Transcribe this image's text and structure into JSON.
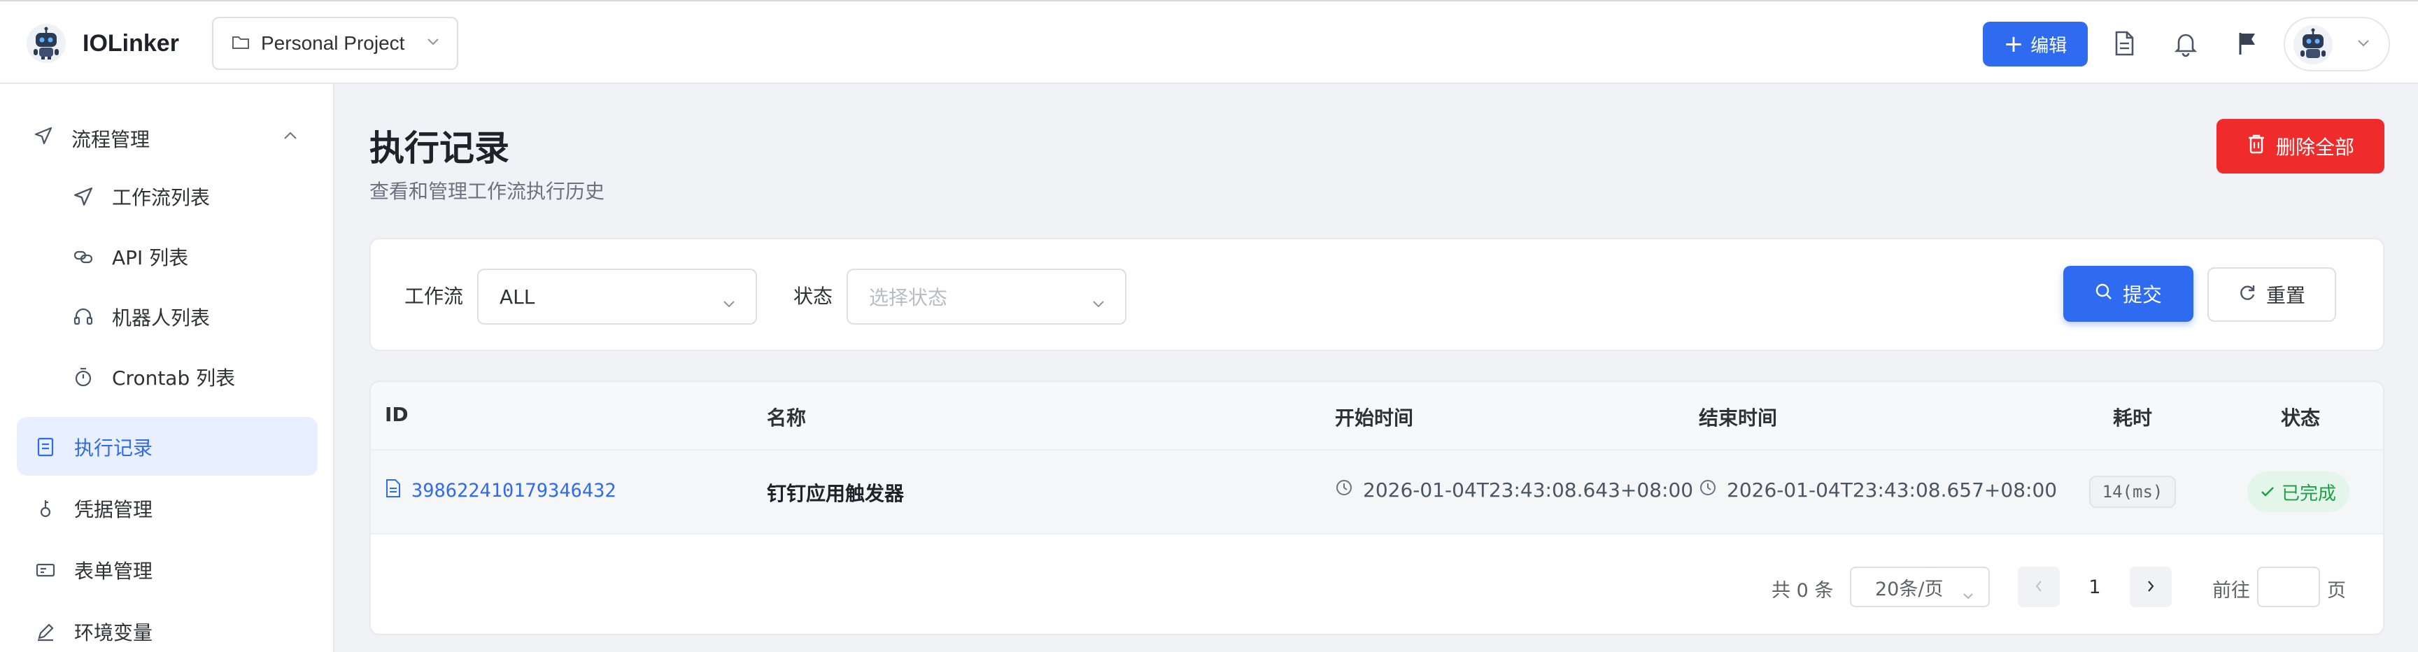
{
  "app": {
    "name": "IOLinker"
  },
  "project": {
    "selected": "Personal Project"
  },
  "header": {
    "edit_label": "编辑"
  },
  "sidebar": {
    "group_label": "流程管理",
    "items": [
      {
        "label": "工作流列表"
      },
      {
        "label": "API 列表"
      },
      {
        "label": "机器人列表"
      },
      {
        "label": "Crontab 列表"
      },
      {
        "label": "执行记录"
      },
      {
        "label": "凭据管理"
      },
      {
        "label": "表单管理"
      },
      {
        "label": "环境变量"
      }
    ]
  },
  "page": {
    "title": "执行记录",
    "subtitle": "查看和管理工作流执行历史",
    "delete_all_label": "删除全部"
  },
  "filter": {
    "workflow_label": "工作流",
    "workflow_value": "ALL",
    "status_label": "状态",
    "status_placeholder": "选择状态",
    "submit_label": "提交",
    "reset_label": "重置"
  },
  "table": {
    "columns": [
      "ID",
      "名称",
      "开始时间",
      "结束时间",
      "耗时",
      "状态"
    ],
    "rows": [
      {
        "id": "398622410179346432",
        "name": "钉钉应用触发器",
        "start": "2026-01-04T23:43:08.643+08:00",
        "end": "2026-01-04T23:43:08.657+08:00",
        "duration": "14(ms)",
        "status": "已完成"
      }
    ]
  },
  "pagination": {
    "total_text": "共 0 条",
    "page_size": "20条/页",
    "current_page": "1",
    "goto_prefix": "前往",
    "goto_suffix": "页"
  },
  "colors": {
    "primary": "#2f6bf0",
    "danger": "#ef2b2b",
    "success": "#1e9e4a",
    "active_bg": "#e8efff"
  }
}
